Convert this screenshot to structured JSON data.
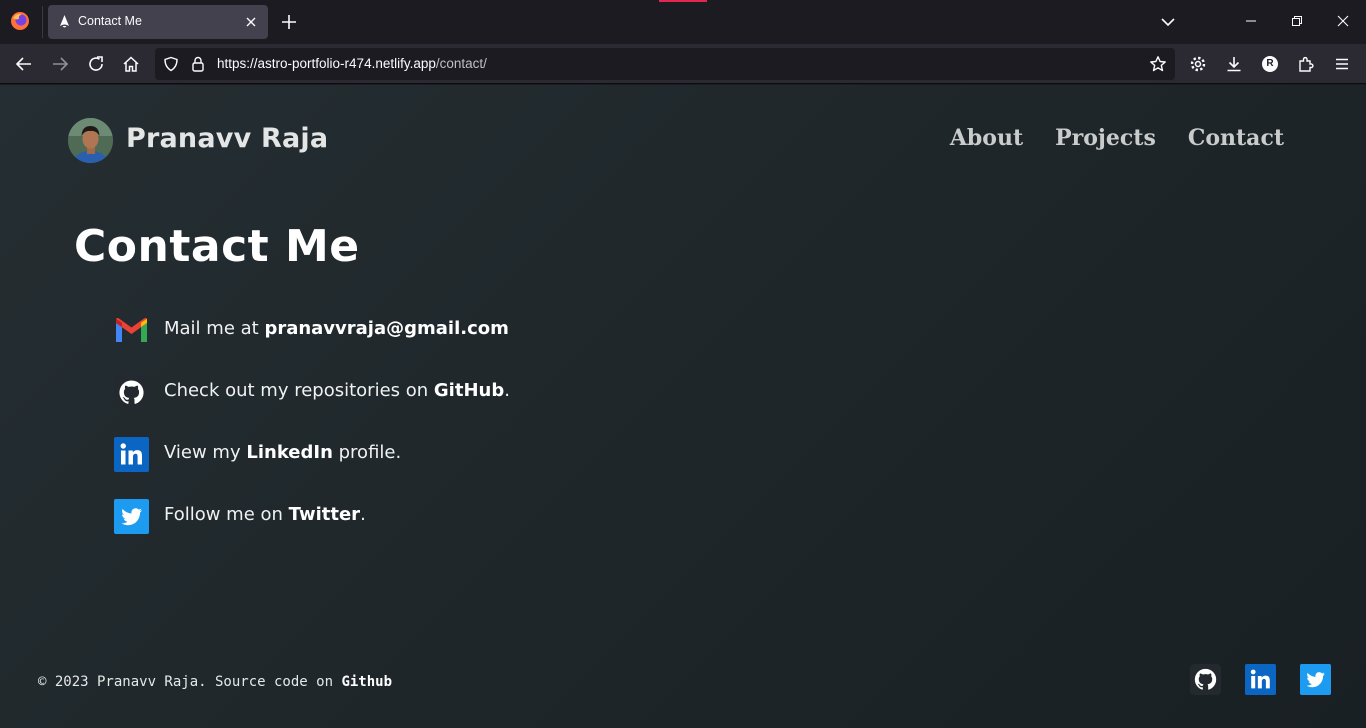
{
  "browser": {
    "tab_title": "Contact Me",
    "url_host": "https://astro-portfolio-r474.netlify.app",
    "url_path": "/contact/",
    "profile_initial": "R"
  },
  "site": {
    "brand": "Pranavv Raja",
    "nav": [
      "About",
      "Projects",
      "Contact"
    ]
  },
  "page": {
    "title": "Contact Me",
    "contacts": [
      {
        "icon": "gmail-icon",
        "prefix": "Mail me at ",
        "strong": "pranavvraja@gmail.com",
        "suffix": ""
      },
      {
        "icon": "github-icon",
        "prefix": "Check out my repositories on ",
        "strong": "GitHub",
        "suffix": "."
      },
      {
        "icon": "linkedin-icon",
        "prefix": "View my ",
        "strong": "LinkedIn",
        "suffix": " profile."
      },
      {
        "icon": "twitter-icon",
        "prefix": "Follow me on ",
        "strong": "Twitter",
        "suffix": "."
      }
    ]
  },
  "footer": {
    "copyright": "© 2023 Pranavv Raja. Source code on ",
    "link": "Github"
  },
  "colors": {
    "linkedin": "#0a66c2",
    "twitter": "#1d9bf0",
    "github_bg": "#24292f"
  }
}
